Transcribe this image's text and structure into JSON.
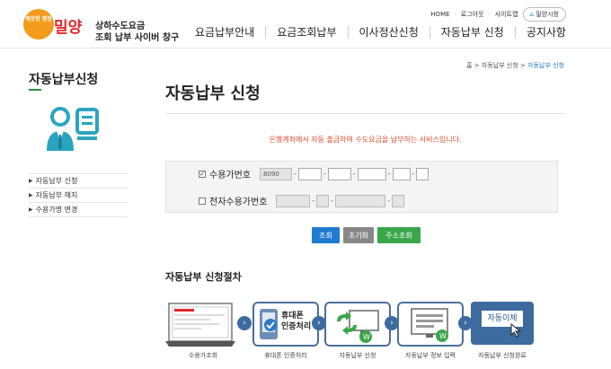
{
  "header": {
    "logo_badge": "깨끗한 청정",
    "logo_city": "밀양",
    "logo_line1": "상하수도요금",
    "logo_line2": "조회 납부 사이버 창구",
    "utility": [
      "HOME",
      "로그아웃",
      "사이트맵"
    ],
    "site_button": "밀양시청",
    "nav": [
      "요금납부안내",
      "요금조회납부",
      "이사정산신청",
      "자동납부 신청",
      "공지사항"
    ]
  },
  "sidebar": {
    "title": "자동납부신청",
    "icon": "user-document-icon",
    "items": [
      "자동납부 신청",
      "자동납부 해지",
      "수용가명 변경"
    ]
  },
  "breadcrumb": {
    "home": "홈",
    "sep": ">",
    "level1": "자동납부 신청",
    "current": "자동납부 신청"
  },
  "main": {
    "title": "자동납부 신청",
    "notice": "은행계좌에서 자동 출금하여 수도요금을 납부하는 서비스입니다.",
    "form": {
      "row1_label": "수용가번호",
      "row1_checked": true,
      "row1_prefix": "8090",
      "row2_label": "전자수용가번호",
      "row2_checked": false
    },
    "buttons": {
      "search": "조회",
      "reset": "초기화",
      "cancel": "주소조회"
    },
    "process_title": "자동납부 신청절차",
    "steps": [
      {
        "caption": "수용가조회",
        "label": ""
      },
      {
        "caption": "휴대폰 인증처리",
        "label": "휴대폰\n인증처리"
      },
      {
        "caption": "자동납부 신청",
        "label": ""
      },
      {
        "caption": "자동납부 정보 입력",
        "label": ""
      },
      {
        "caption": "자동납부 신청완료",
        "label": "자동이체"
      }
    ]
  },
  "colors": {
    "accent_blue": "#1e7bd0",
    "notice_red": "#e04a2b",
    "logo_red": "#e1252b",
    "green": "#3aa64a",
    "step_border": "#4b6f9b"
  }
}
